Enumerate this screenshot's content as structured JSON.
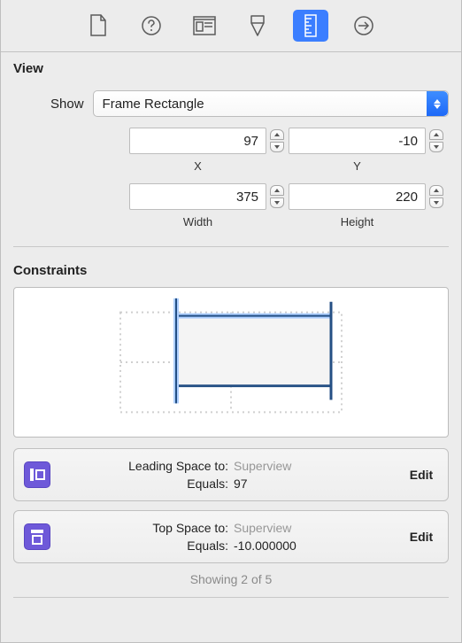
{
  "toolbar": {
    "tabs": [
      "file",
      "help",
      "identity",
      "attributes",
      "size",
      "connections"
    ],
    "selected": "size"
  },
  "view": {
    "section_title": "View",
    "show_label": "Show",
    "show_value": "Frame Rectangle",
    "x_label": "X",
    "y_label": "Y",
    "width_label": "Width",
    "height_label": "Height",
    "x": "97",
    "y": "-10",
    "width": "375",
    "height": "220"
  },
  "constraints": {
    "section_title": "Constraints",
    "items": [
      {
        "icon": "leading-constraint-icon",
        "label": "Leading Space to:",
        "target": "Superview",
        "relation_label": "Equals:",
        "value": "97",
        "edit": "Edit"
      },
      {
        "icon": "top-constraint-icon",
        "label": "Top Space to:",
        "target": "Superview",
        "relation_label": "Equals:",
        "value": "-10.000000",
        "edit": "Edit"
      }
    ],
    "footer": "Showing 2 of 5"
  }
}
